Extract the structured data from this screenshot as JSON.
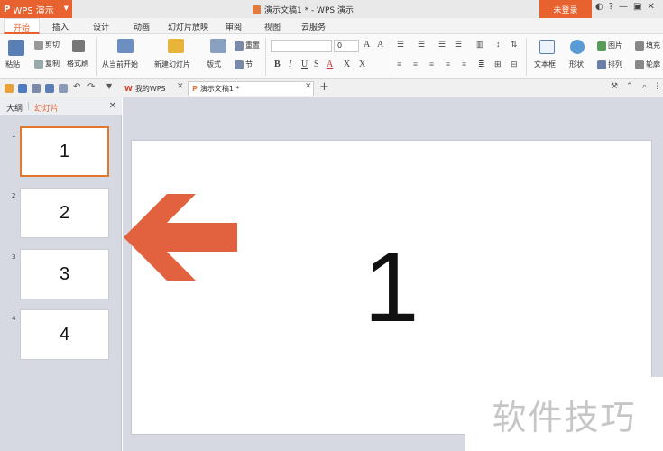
{
  "titlebar": {
    "app_name": "WPS 演示",
    "window_title": "演示文稿1 * - WPS 演示",
    "login_label": "未登录"
  },
  "menu": {
    "tabs": [
      "开始",
      "插入",
      "设计",
      "动画",
      "幻灯片放映",
      "审阅",
      "视图",
      "云服务"
    ],
    "active_tab": "开始"
  },
  "ribbon": {
    "paste": "粘贴",
    "cut": "剪切",
    "copy": "复制",
    "format_painter": "格式刷",
    "from_current": "从当前开始",
    "new_slide": "新建幻灯片",
    "layout": "版式",
    "reset": "重置",
    "section": "节",
    "font_size": "0",
    "text_box": "文本框",
    "shape": "形状",
    "picture": "图片",
    "arrange": "排列",
    "fill": "填充",
    "outline": "轮廓"
  },
  "doc_tabs": {
    "home_tab": "我的WPS",
    "doc_tab": "演示文稿1 *"
  },
  "panel": {
    "outline_tab": "大纲",
    "slides_tab": "幻灯片",
    "slides": [
      {
        "num": "1",
        "content": "1"
      },
      {
        "num": "2",
        "content": "2"
      },
      {
        "num": "3",
        "content": "3"
      },
      {
        "num": "4",
        "content": "4"
      }
    ]
  },
  "slide": {
    "content": "1"
  },
  "watermark": "软件技巧",
  "colors": {
    "accent": "#e8622f",
    "arrow": "#e2623f",
    "workspace": "#d6d9e1"
  }
}
